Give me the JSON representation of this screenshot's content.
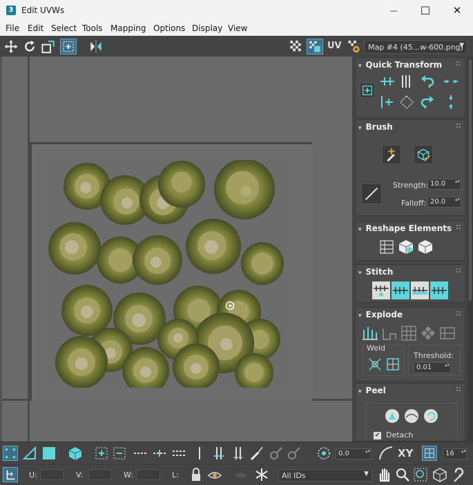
{
  "window": {
    "title": "Edit UVWs",
    "app_icon": "3",
    "minimize": "—",
    "maximize": "☐",
    "close": "✕"
  },
  "menu": [
    "File",
    "Edit",
    "Select",
    "Tools",
    "Mapping",
    "Options",
    "Display",
    "View"
  ],
  "toolbar": {
    "uv_label": "UV",
    "map_selector": "Map #4 (45...w-600.png)"
  },
  "panels": {
    "quick_transform": {
      "title": "Quick Transform"
    },
    "brush": {
      "title": "Brush",
      "strength_label": "Strength:",
      "strength_value": "10.0",
      "falloff_label": "Falloff:",
      "falloff_value": "20.0"
    },
    "reshape": {
      "title": "Reshape Elements"
    },
    "stitch": {
      "title": "Stitch"
    },
    "explode": {
      "title": "Explode",
      "weld_label": "Weld",
      "threshold_label": "Threshold:",
      "threshold_value": "0.01"
    },
    "peel": {
      "title": "Peel",
      "detach_label": "Detach",
      "detach_checked": "✔"
    }
  },
  "bottom_bar": {
    "offset_value": "0.0",
    "xy_label": "XY",
    "grid_value": "16"
  },
  "status_bar": {
    "u_label": "U:",
    "v_label": "V:",
    "w_label": "W:",
    "l_label": "L:",
    "ids_value": "All IDs"
  },
  "colors": {
    "accent": "#5fd6dc",
    "panel_bg": "#4c4c4c",
    "viewport_bg": "#6a6a6a",
    "pepper_green": "#6b7422",
    "pepper_seed": "#d7c79a"
  },
  "icons": [
    "move-icon",
    "rotate-icon",
    "scale-icon",
    "freeform-icon",
    "mirror-icon",
    "checker-icon",
    "map-icon",
    "uv-icon",
    "map-settings-icon"
  ]
}
